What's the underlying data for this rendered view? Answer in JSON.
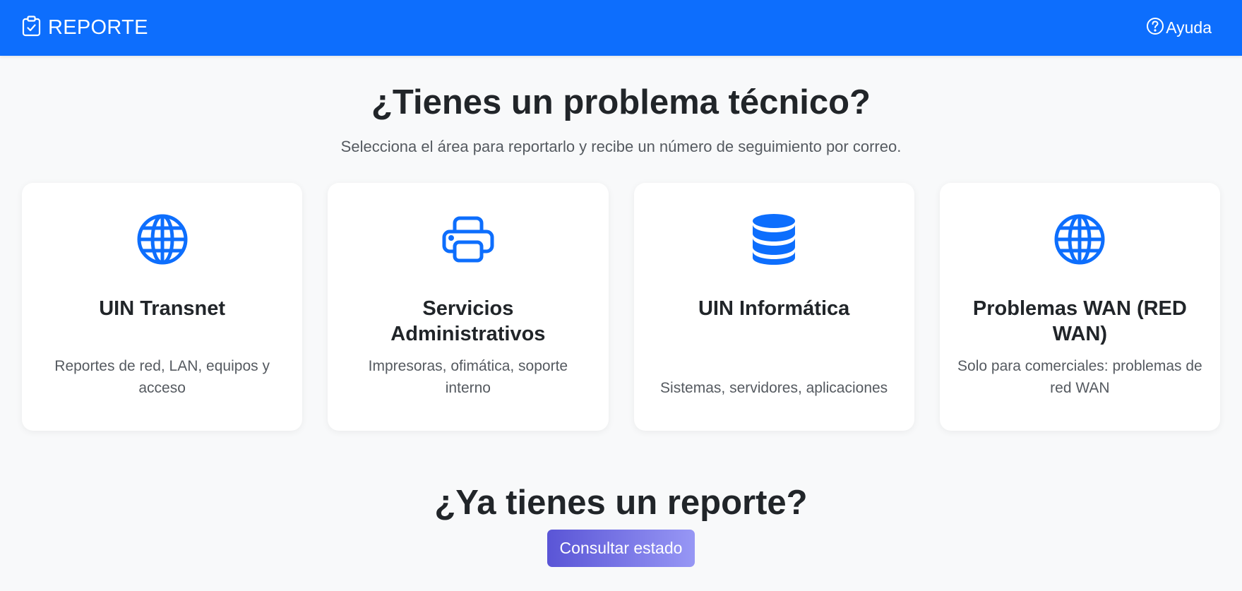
{
  "navbar": {
    "brand": "REPORTE",
    "help": "Ayuda",
    "brand_icon": "clipboard-check-icon",
    "help_icon": "question-circle-icon"
  },
  "hero": {
    "title": "¿Tienes un problema técnico?",
    "subtitle": "Selecciona el área para reportarlo y recibe un número de seguimiento por correo."
  },
  "cards": [
    {
      "title": "UIN Transnet",
      "description": "Reportes de red, LAN, equipos y acceso",
      "icon": "globe-icon"
    },
    {
      "title": "Servicios Administrativos",
      "description": "Impresoras, ofimática, soporte interno",
      "icon": "printer-icon"
    },
    {
      "title": "UIN Informática",
      "description": "Sistemas, servidores, aplicaciones",
      "icon": "database-icon"
    },
    {
      "title": "Problemas WAN (RED WAN)",
      "description": "Solo para comerciales: problemas de red WAN",
      "icon": "globe-icon"
    }
  ],
  "followup": {
    "title": "¿Ya tienes un reporte?",
    "button": "Consultar estado"
  },
  "colors": {
    "primary": "#0d6efd",
    "background": "#f8f9fa",
    "button_gradient_start": "#5a55d6",
    "button_gradient_end": "#9797f5"
  }
}
